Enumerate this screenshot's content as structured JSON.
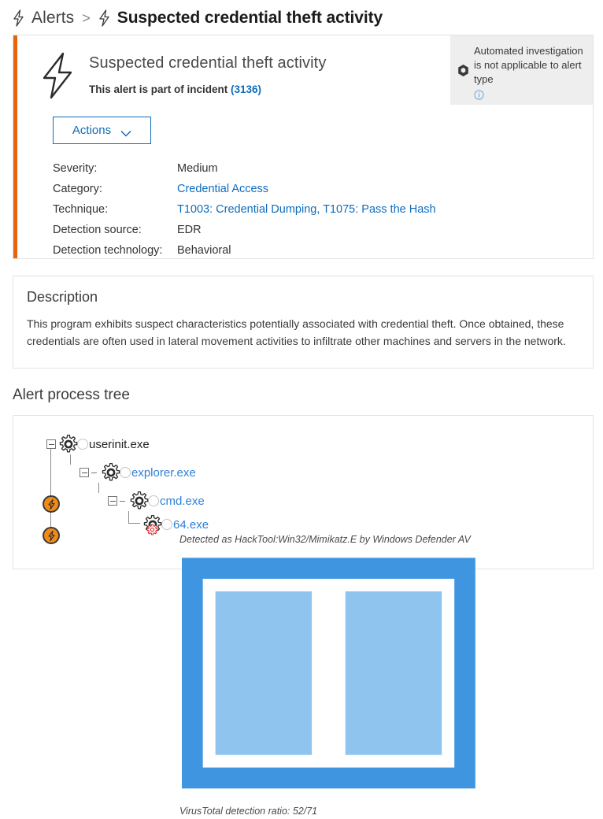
{
  "breadcrumb": {
    "parent_label": "Alerts",
    "separator": ">",
    "current_label": "Suspected credential theft activity",
    "parent_icon": "alert-bolt-icon",
    "current_icon": "alert-bolt-icon"
  },
  "alert": {
    "icon": "alert-bolt-icon",
    "title": "Suspected credential theft activity",
    "incident_prefix": "This alert is part of incident ",
    "incident_id": "(3136)",
    "actions_label": "Actions",
    "actions_chevron": "chevron-down-icon",
    "accent_color": "#e8640c",
    "link_color": "#0f6cbd",
    "meta": [
      {
        "label": "Severity:",
        "value": "Medium",
        "is_link": false
      },
      {
        "label": "Category:",
        "value": "Credential Access",
        "is_link": true
      },
      {
        "label": "Technique:",
        "value": "T1003: Credential Dumping, T1075: Pass the Hash",
        "is_link": true
      },
      {
        "label": "Detection source:",
        "value": "EDR",
        "is_link": false
      },
      {
        "label": "Detection technology:",
        "value": "Behavioral",
        "is_link": false
      }
    ],
    "automated_investigation": {
      "icon": "defender-shield-icon",
      "text": "Automated investigation is not applicable to alert type",
      "info_icon": "info-circle-icon"
    }
  },
  "description": {
    "title": "Description",
    "body": "This program exhibits suspect characteristics potentially associated with credential theft. Once obtained, these credentials are often used in lateral movement activities to infiltrate other machines and servers in the network."
  },
  "process_tree": {
    "heading": "Alert process tree",
    "nodes": [
      {
        "name": "userinit.exe",
        "is_link": false,
        "malicious": false
      },
      {
        "name": "explorer.exe",
        "is_link": true,
        "malicious": false
      },
      {
        "name": "cmd.exe",
        "is_link": true,
        "malicious": false
      },
      {
        "name": "64.exe",
        "is_link": true,
        "malicious": true
      }
    ],
    "detection_line_1": "Detected as HackTool:Win32/Mimikatz.E by Windows Defender AV",
    "detection_line_2": "VirusTotal detection ratio: 52/71",
    "detection_doc_icon": "book-icon",
    "alert_marker_icon": "alert-bolt-badge-icon",
    "alert_marker_color": "#f28a17"
  }
}
